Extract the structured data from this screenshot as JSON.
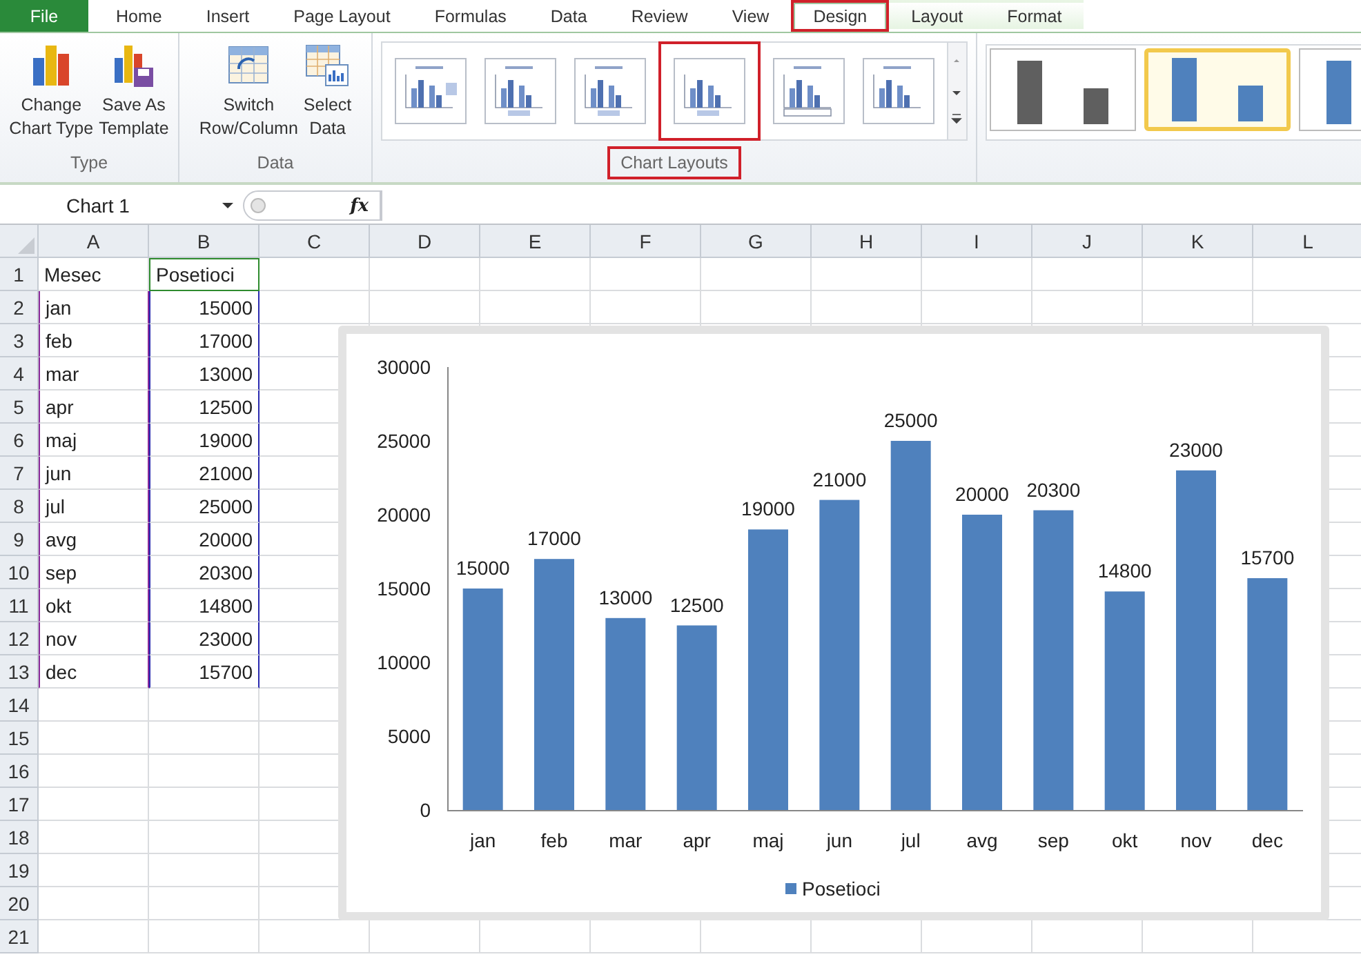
{
  "tabs": [
    {
      "label": "File",
      "kind": "file",
      "selected": false,
      "highlighted": false
    },
    {
      "label": "Home",
      "kind": "normal",
      "selected": false,
      "highlighted": false
    },
    {
      "label": "Insert",
      "kind": "normal",
      "selected": false,
      "highlighted": false
    },
    {
      "label": "Page Layout",
      "kind": "normal",
      "selected": false,
      "highlighted": false
    },
    {
      "label": "Formulas",
      "kind": "normal",
      "selected": false,
      "highlighted": false
    },
    {
      "label": "Data",
      "kind": "normal",
      "selected": false,
      "highlighted": false
    },
    {
      "label": "Review",
      "kind": "normal",
      "selected": false,
      "highlighted": false
    },
    {
      "label": "View",
      "kind": "normal",
      "selected": false,
      "highlighted": false
    },
    {
      "label": "Design",
      "kind": "contextual",
      "selected": true,
      "highlighted": true
    },
    {
      "label": "Layout",
      "kind": "contextual",
      "selected": false,
      "highlighted": false
    },
    {
      "label": "Format",
      "kind": "contextual",
      "selected": false,
      "highlighted": false
    }
  ],
  "ribbon": {
    "groups": [
      {
        "label": "Type",
        "kind": "buttons",
        "buttons": [
          {
            "lines": [
              "Change",
              "Chart Type"
            ]
          },
          {
            "lines": [
              "Save As",
              "Template"
            ]
          }
        ]
      },
      {
        "label": "Data",
        "kind": "buttons",
        "buttons": [
          {
            "lines": [
              "Switch",
              "Row/Column"
            ]
          },
          {
            "lines": [
              "Select",
              "Data"
            ]
          }
        ]
      },
      {
        "label": "Chart Layouts",
        "kind": "layouts",
        "highlighted": true,
        "layouts": [
          {
            "highlighted": false
          },
          {
            "highlighted": false
          },
          {
            "highlighted": false
          },
          {
            "highlighted": true
          },
          {
            "highlighted": false
          },
          {
            "highlighted": false
          }
        ]
      },
      {
        "kind": "styles",
        "styles": [
          {
            "color": "#5f5f5f",
            "selected": false
          },
          {
            "color": "#4f81bd",
            "selected": true
          },
          {
            "color": "#4f81bd",
            "selected": false
          }
        ]
      }
    ]
  },
  "formula_bar": {
    "name_box": "Chart 1",
    "function_label": "fx"
  },
  "sheet": {
    "columns": [
      "A",
      "B",
      "C",
      "D",
      "E",
      "F",
      "G",
      "H",
      "I",
      "J",
      "K",
      "L"
    ],
    "rows": [
      {
        "header": "1",
        "cells": [
          "Mesec",
          "Posetioci"
        ]
      },
      {
        "header": "2",
        "cells": [
          "jan",
          "15000"
        ]
      },
      {
        "header": "3",
        "cells": [
          "feb",
          "17000"
        ]
      },
      {
        "header": "4",
        "cells": [
          "mar",
          "13000"
        ]
      },
      {
        "header": "5",
        "cells": [
          "apr",
          "12500"
        ]
      },
      {
        "header": "6",
        "cells": [
          "maj",
          "19000"
        ]
      },
      {
        "header": "7",
        "cells": [
          "jun",
          "21000"
        ]
      },
      {
        "header": "8",
        "cells": [
          "jul",
          "25000"
        ]
      },
      {
        "header": "9",
        "cells": [
          "avg",
          "20000"
        ]
      },
      {
        "header": "10",
        "cells": [
          "sep",
          "20300"
        ]
      },
      {
        "header": "11",
        "cells": [
          "okt",
          "14800"
        ]
      },
      {
        "header": "12",
        "cells": [
          "nov",
          "23000"
        ]
      },
      {
        "header": "13",
        "cells": [
          "dec",
          "15700"
        ]
      },
      {
        "header": "14"
      },
      {
        "header": "15"
      },
      {
        "header": "16"
      },
      {
        "header": "17"
      },
      {
        "header": "18"
      },
      {
        "header": "19"
      },
      {
        "header": "20"
      },
      {
        "header": "21"
      }
    ]
  },
  "chart": {
    "chart_data": {
      "type": "bar",
      "categories": [
        "jan",
        "feb",
        "mar",
        "apr",
        "maj",
        "jun",
        "jul",
        "avg",
        "sep",
        "okt",
        "nov",
        "dec"
      ],
      "series": [
        {
          "name": "Posetioci",
          "color": "#4f81bd",
          "values": [
            15000,
            17000,
            13000,
            12500,
            19000,
            21000,
            25000,
            20000,
            20300,
            14800,
            23000,
            15700
          ]
        }
      ],
      "ylim": [
        0,
        30000
      ],
      "yticks": [
        0,
        5000,
        10000,
        15000,
        20000,
        25000,
        30000
      ],
      "data_labels": true
    }
  }
}
